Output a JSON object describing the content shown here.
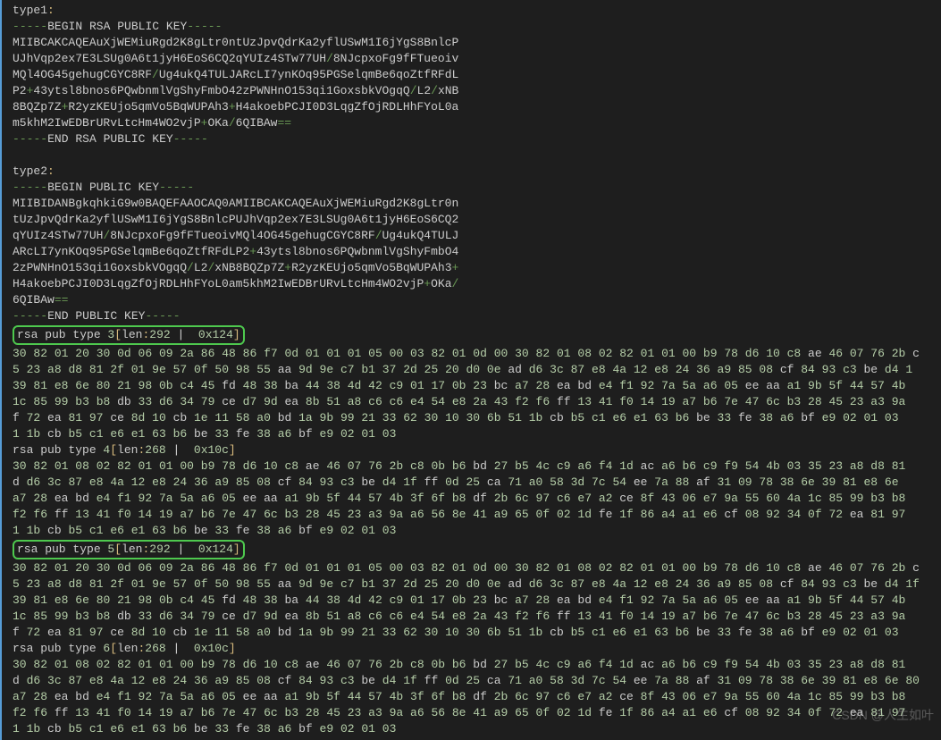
{
  "type1": {
    "label": "type1",
    "begin": "-----BEGIN RSA PUBLIC KEY-----",
    "body": [
      "MIIBCAKCAQEAuXjWEMiuRgd2K8gLtr0ntUzJpvQdrKa2yflUSwM1I6jYgS8BnlcP",
      "UJhVqp2ex7E3LSUg0A6t1jyH6EoS6CQ2qYUIz4STw77UH/8NJcpxoFg9fFTueoiv",
      "MQl4OG45gehugCGYC8RF/Ug4ukQ4TULJARcLI7ynKOq95PGSelqmBe6qoZtfRFdL",
      "P2+43ytsl8bnos6PQwbnmlVgShyFmbO42zPWNHnO153qi1GoxsbkVOgqQ/L2/xNB",
      "8BQZp7Z+R2yzKEUjo5qmVo5BqWUPAh3+H4akoebPCJI0D3LqgZfOjRDLHhFYoL0a",
      "m5khM2IwEDBrURvLtcHm4WO2vjP+OKa/6QIBAw=="
    ],
    "end": "-----END RSA PUBLIC KEY-----"
  },
  "type2": {
    "label": "type2",
    "begin": "-----BEGIN PUBLIC KEY-----",
    "body": [
      "MIIBIDANBgkqhkiG9w0BAQEFAAOCAQ0AMIIBCAKCAQEAuXjWEMiuRgd2K8gLtr0n",
      "tUzJpvQdrKa2yflUSwM1I6jYgS8BnlcPUJhVqp2ex7E3LSUg0A6t1jyH6EoS6CQ2",
      "qYUIz4STw77UH/8NJcpxoFg9fFTueoivMQl4OG45gehugCGYC8RF/Ug4ukQ4TULJ",
      "ARcLI7ynKOq95PGSelqmBe6qoZtfRFdLP2+43ytsl8bnos6PQwbnmlVgShyFmbO4",
      "2zPWNHnO153qi1GoxsbkVOgqQ/L2/xNB8BQZp7Z+R2yzKEUjo5qmVo5BqWUPAh3+",
      "H4akoebPCJI0D3LqgZfOjRDLHhFYoL0am5khM2IwEDBrURvLtcHm4WO2vjP+OKa/",
      "6QIBAw=="
    ],
    "end": "-----END PUBLIC KEY-----"
  },
  "dump3": {
    "header": {
      "label": "rsa pub type ",
      "typeNum": "3",
      "lenLabel": "len",
      "len": "292",
      "hex": "0x124"
    },
    "lines": [
      "30 82 01 20 30 0d 06 09 2a 86 48 86 f7 0d 01 01 01 05 00 03 82 01 0d 00 30 82 01 08 02 82 01 01 00 b9 78 d6 10 c8 ae 46 07 76 2b c",
      "5 23 a8 d8 81 2f 01 9e 57 0f 50 98 55 aa 9d 9e c7 b1 37 2d 25 20 d0 0e ad d6 3c 87 e8 4a 12 e8 24 36 a9 85 08 cf 84 93 c3 be d4 1",
      "39 81 e8 6e 80 21 98 0b c4 45 fd 48 38 ba 44 38 4d 42 c9 01 17 0b 23 bc a7 28 ea bd e4 f1 92 7a 5a a6 05 ee aa a1 9b 5f 44 57 4b",
      "1c 85 99 b3 b8 db 33 d6 34 79 ce d7 9d ea 8b 51 a8 c6 c6 e4 54 e8 2a 43 f2 f6 ff 13 41 f0 14 19 a7 b6 7e 47 6c b3 28 45 23 a3 9a",
      "f 72 ea 81 97 ce 8d 10 cb 1e 11 58 a0 bd 1a 9b 99 21 33 62 30 10 30 6b 51 1b cb b5 c1 e6 e1 63 b6 be 33 fe 38 a6 bf e9 02 01 03",
      "1 1b cb b5 c1 e6 e1 63 b6 be 33 fe 38 a6 bf e9 02 01 03"
    ]
  },
  "dump4": {
    "header": {
      "label": "rsa pub type ",
      "typeNum": "4",
      "lenLabel": "len",
      "len": "268",
      "hex": "0x10c"
    },
    "lines": [
      "30 82 01 08 02 82 01 01 00 b9 78 d6 10 c8 ae 46 07 76 2b c8 0b b6 bd 27 b5 4c c9 a6 f4 1d ac a6 b6 c9 f9 54 4b 03 35 23 a8 d8 81",
      "d d6 3c 87 e8 4a 12 e8 24 36 a9 85 08 cf 84 93 c3 be d4 1f ff 0d 25 ca 71 a0 58 3d 7c 54 ee 7a 88 af 31 09 78 38 6e 39 81 e8 6e",
      "a7 28 ea bd e4 f1 92 7a 5a a6 05 ee aa a1 9b 5f 44 57 4b 3f 6f b8 df 2b 6c 97 c6 e7 a2 ce 8f 43 06 e7 9a 55 60 4a 1c 85 99 b3 b8",
      "f2 f6 ff 13 41 f0 14 19 a7 b6 7e 47 6c b3 28 45 23 a3 9a a6 56 8e 41 a9 65 0f 02 1d fe 1f 86 a4 a1 e6 cf 08 92 34 0f 72 ea 81 97",
      "1 1b cb b5 c1 e6 e1 63 b6 be 33 fe 38 a6 bf e9 02 01 03"
    ]
  },
  "dump5": {
    "header": {
      "label": "rsa pub type ",
      "typeNum": "5",
      "lenLabel": "len",
      "len": "292",
      "hex": "0x124"
    },
    "lines": [
      "30 82 01 20 30 0d 06 09 2a 86 48 86 f7 0d 01 01 01 05 00 03 82 01 0d 00 30 82 01 08 02 82 01 01 00 b9 78 d6 10 c8 ae 46 07 76 2b c",
      "5 23 a8 d8 81 2f 01 9e 57 0f 50 98 55 aa 9d 9e c7 b1 37 2d 25 20 d0 0e ad d6 3c 87 e8 4a 12 e8 24 36 a9 85 08 cf 84 93 c3 be d4 1f",
      "39 81 e8 6e 80 21 98 0b c4 45 fd 48 38 ba 44 38 4d 42 c9 01 17 0b 23 bc a7 28 ea bd e4 f1 92 7a 5a a6 05 ee aa a1 9b 5f 44 57 4b",
      "1c 85 99 b3 b8 db 33 d6 34 79 ce d7 9d ea 8b 51 a8 c6 c6 e4 54 e8 2a 43 f2 f6 ff 13 41 f0 14 19 a7 b6 7e 47 6c b3 28 45 23 a3 9a",
      "f 72 ea 81 97 ce 8d 10 cb 1e 11 58 a0 bd 1a 9b 99 21 33 62 30 10 30 6b 51 1b cb b5 c1 e6 e1 63 b6 be 33 fe 38 a6 bf e9 02 01 03"
    ]
  },
  "dump6": {
    "header": {
      "label": "rsa pub type ",
      "typeNum": "6",
      "lenLabel": "len",
      "len": "268",
      "hex": "0x10c"
    },
    "lines": [
      "30 82 01 08 02 82 01 01 00 b9 78 d6 10 c8 ae 46 07 76 2b c8 0b b6 bd 27 b5 4c c9 a6 f4 1d ac a6 b6 c9 f9 54 4b 03 35 23 a8 d8 81",
      "d d6 3c 87 e8 4a 12 e8 24 36 a9 85 08 cf 84 93 c3 be d4 1f ff 0d 25 ca 71 a0 58 3d 7c 54 ee 7a 88 af 31 09 78 38 6e 39 81 e8 6e 80",
      "a7 28 ea bd e4 f1 92 7a 5a a6 05 ee aa a1 9b 5f 44 57 4b 3f 6f b8 df 2b 6c 97 c6 e7 a2 ce 8f 43 06 e7 9a 55 60 4a 1c 85 99 b3 b8",
      "f2 f6 ff 13 41 f0 14 19 a7 b6 7e 47 6c b3 28 45 23 a3 9a a6 56 8e 41 a9 65 0f 02 1d fe 1f 86 a4 a1 e6 cf 08 92 34 0f 72 ea 81 97",
      "1 1b cb b5 c1 e6 e1 63 b6 be 33 fe 38 a6 bf e9 02 01 03"
    ]
  },
  "watermark": "CSDN @人生如叶"
}
